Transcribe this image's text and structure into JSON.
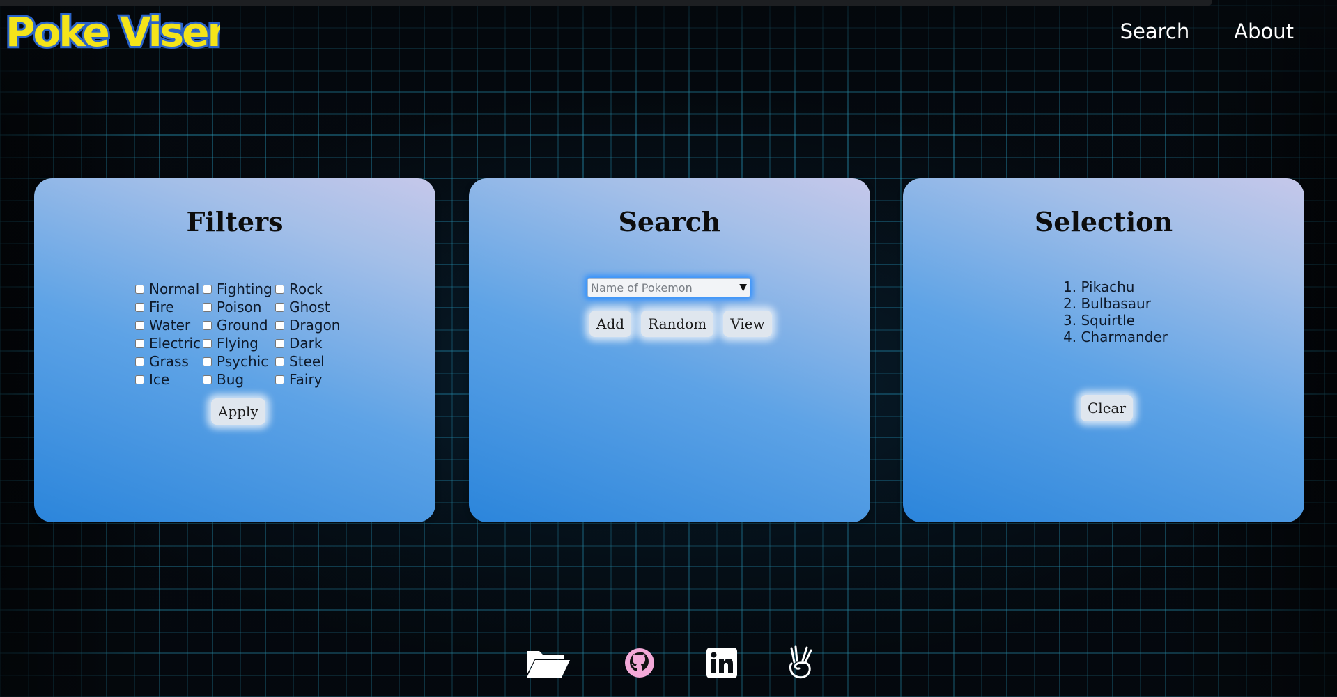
{
  "brand": {
    "logo_text": "Poke Viser"
  },
  "nav": {
    "search": "Search",
    "about": "About"
  },
  "filters": {
    "title": "Filters",
    "types": [
      "Normal",
      "Fighting",
      "Rock",
      "Fire",
      "Poison",
      "Ghost",
      "Water",
      "Ground",
      "Dragon",
      "Electric",
      "Flying",
      "Dark",
      "Grass",
      "Psychic",
      "Steel",
      "Ice",
      "Bug",
      "Fairy"
    ],
    "apply_label": "Apply"
  },
  "search": {
    "title": "Search",
    "select_placeholder": "Name of Pokemon",
    "add_label": "Add",
    "random_label": "Random",
    "view_label": "View"
  },
  "selection": {
    "title": "Selection",
    "items": [
      "1. Pikachu",
      "2. Bulbasaur",
      "3. Squirtle",
      "4. Charmander"
    ],
    "clear_label": "Clear"
  },
  "footer": {
    "icons": [
      "folder-icon",
      "github-icon",
      "linkedin-icon",
      "angellist-icon"
    ]
  },
  "colors": {
    "logo_yellow": "#f4e41a",
    "logo_blue": "#2a63c8",
    "select_glow": "#2b8cff",
    "github_pink": "#f3a9d8"
  }
}
